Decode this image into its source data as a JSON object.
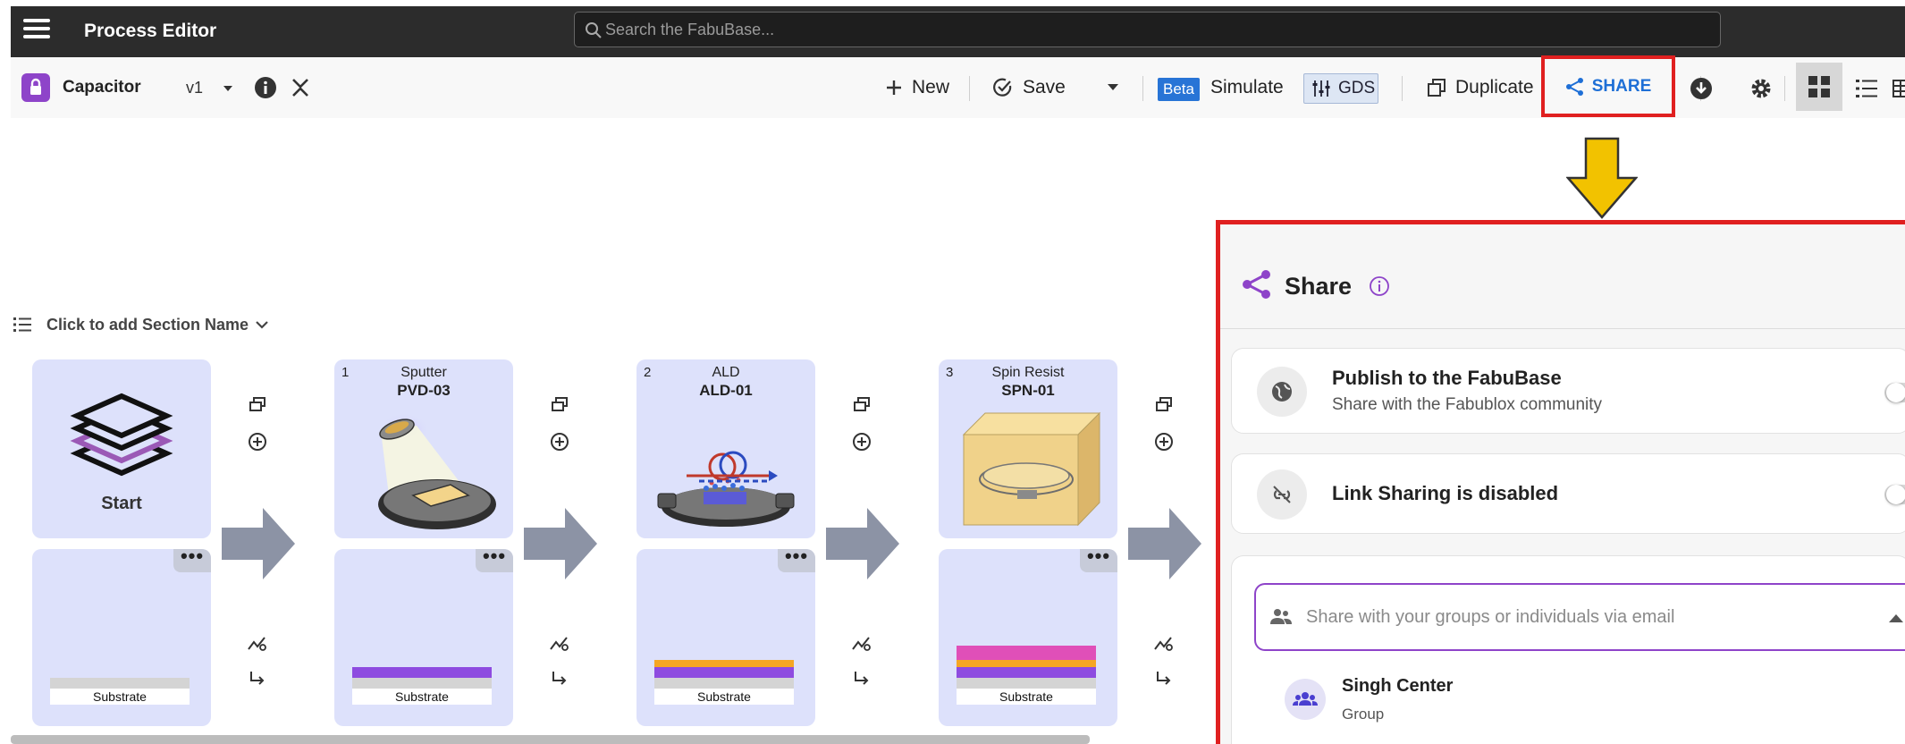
{
  "topbar": {
    "app_title": "Process Editor",
    "search_placeholder": "Search the FabuBase..."
  },
  "toolbar": {
    "project_name": "Capacitor",
    "version": "v1",
    "new_label": "New",
    "save_label": "Save",
    "beta_badge": "Beta",
    "simulate_label": "Simulate",
    "gds_label": "GDS",
    "duplicate_label": "Duplicate",
    "share_label": "SHARE"
  },
  "section": {
    "name_placeholder": "Click to add Section Name"
  },
  "flow": {
    "start_label": "Start",
    "steps": [
      {
        "num": "1",
        "type": "Sputter",
        "code": "PVD-03"
      },
      {
        "num": "2",
        "type": "ALD",
        "code": "ALD-01"
      },
      {
        "num": "3",
        "type": "Spin Resist",
        "code": "SPN-01"
      }
    ],
    "substrate_label": "Substrate",
    "more_label": "•••"
  },
  "share_panel": {
    "title": "Share",
    "publish_title": "Publish to the FabuBase",
    "publish_sub": "Share with the Fabublox community",
    "link_title": "Link Sharing is disabled",
    "share_placeholder": "Share with your groups or individuals via email",
    "group_name": "Singh Center",
    "group_type": "Group"
  },
  "colors": {
    "topbar_bg": "#2c2c2c",
    "card_bg": "#dde1fb",
    "accent_purple": "#8e44c9",
    "share_blue": "#1e6fd6",
    "highlight_red": "#e02020",
    "arrow_yellow": "#f2c200",
    "layer_purple": "#8e4be0",
    "layer_orange": "#f5a623",
    "layer_pink": "#e04fb8"
  }
}
